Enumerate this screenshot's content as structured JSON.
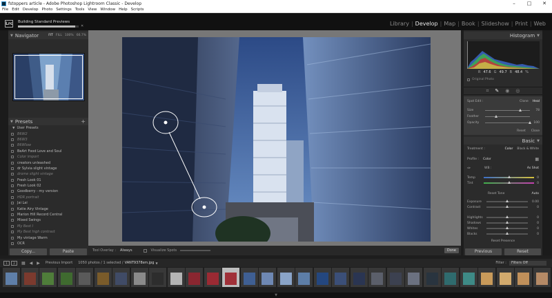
{
  "window": {
    "title": "fstoppers article - Adobe Photoshop Lightroom Classic - Develop"
  },
  "menu": [
    "File",
    "Edit",
    "Develop",
    "Photo",
    "Settings",
    "Tools",
    "View",
    "Window",
    "Help",
    "Scripts"
  ],
  "identity": {
    "logo": "Lrc",
    "task": "Building Standard Previews",
    "task_progress_pct": 94
  },
  "modules": [
    "Library",
    "Develop",
    "Map",
    "Book",
    "Slideshow",
    "Print",
    "Web"
  ],
  "active_module": "Develop",
  "navigator": {
    "title": "Navigator",
    "options": [
      "FIT",
      "FILL",
      "100%",
      "66.7%"
    ]
  },
  "presets": {
    "title": "Presets",
    "group": "User Presets",
    "items": [
      {
        "label": "B6W2",
        "dim": true
      },
      {
        "label": "B6W3",
        "dim": true
      },
      {
        "label": "B6Wlow",
        "dim": true
      },
      {
        "label": "BeArt Food Love and Soul",
        "dim": false
      },
      {
        "label": "Color import",
        "dim": true
      },
      {
        "label": "creators unleashed",
        "dim": false
      },
      {
        "label": "dr Sylvia slight vintage",
        "dim": false
      },
      {
        "label": "drome slight vintage",
        "dim": true
      },
      {
        "label": "Fresh Look 01",
        "dim": false
      },
      {
        "label": "Fresh Look 02",
        "dim": false
      },
      {
        "label": "Goodberry - my version",
        "dim": false
      },
      {
        "label": "HDR portrait",
        "dim": true
      },
      {
        "label": "Jai Lai",
        "dim": false
      },
      {
        "label": "Katie Airy Vintage",
        "dim": false
      },
      {
        "label": "Marion Hill Record Central",
        "dim": false
      },
      {
        "label": "Mixed Swings",
        "dim": false
      },
      {
        "label": "My Best I",
        "dim": true
      },
      {
        "label": "My Best high contrast",
        "dim": true
      },
      {
        "label": "My vintage Warm",
        "dim": false
      },
      {
        "label": "OCR",
        "dim": false
      }
    ]
  },
  "left_buttons": {
    "copy": "Copy...",
    "paste": "Paste"
  },
  "toolbar": {
    "tool_overlay_label": "Tool Overlay :",
    "tool_overlay_value": "Always",
    "visualize_spots": "Visualize Spots",
    "done": "Done"
  },
  "histogram": {
    "title": "Histogram",
    "readout": [
      {
        "label": "R",
        "value": "47.6"
      },
      {
        "label": "G",
        "value": "49.7"
      },
      {
        "label": "B",
        "value": "48.4"
      }
    ],
    "readout_unit": "%",
    "original_photo": "Original Photo"
  },
  "spot_removal": {
    "label": "Spot Edit :",
    "modes": [
      "Clone",
      "Heal"
    ],
    "active_mode": "Heal",
    "sliders": [
      {
        "label": "Size",
        "value": "78",
        "level": 0.78
      },
      {
        "label": "Feather",
        "value": "",
        "level": 0.25
      },
      {
        "label": "Opacity",
        "value": "100",
        "level": 1.0
      }
    ],
    "reset": "Reset",
    "close": "Close"
  },
  "basic": {
    "title": "Basic",
    "treatment_label": "Treatment :",
    "treatment_options": [
      "Color",
      "Black & White"
    ],
    "profile_label": "Profile :",
    "profile_value": "Color",
    "wb_label": "WB :",
    "wb_value": "As Shot",
    "temp": {
      "label": "Temp",
      "value": "0",
      "level": 0.5
    },
    "tint": {
      "label": "Tint",
      "value": "0",
      "level": 0.5
    },
    "tone_label": "Reset Tone",
    "tone_auto": "Auto",
    "sliders": [
      {
        "label": "Exposure",
        "value": "0.00",
        "level": 0.5
      },
      {
        "label": "Contrast",
        "value": "0",
        "level": 0.5
      },
      {
        "label": "Highlights",
        "value": "0",
        "level": 0.5
      },
      {
        "label": "Shadows",
        "value": "0",
        "level": 0.5
      },
      {
        "label": "Whites",
        "value": "0",
        "level": 0.5
      },
      {
        "label": "Blacks",
        "value": "0",
        "level": 0.5
      }
    ],
    "presence": "Reset Presence"
  },
  "right_buttons": {
    "previous": "Previous",
    "reset": "Reset"
  },
  "filmstrip_bar": {
    "pages": [
      "1",
      "2"
    ],
    "source": "Previous Import",
    "count": "1050 photos / 1 selected /",
    "filename": "VANT9378sm.jpg",
    "filter_label": "Filter :",
    "filter_value": "Filters Off"
  },
  "colors": {
    "accent": "#e8e8e8",
    "panel": "#2b2b2b",
    "background": "#1d1d1d",
    "canvas": "#777777"
  }
}
